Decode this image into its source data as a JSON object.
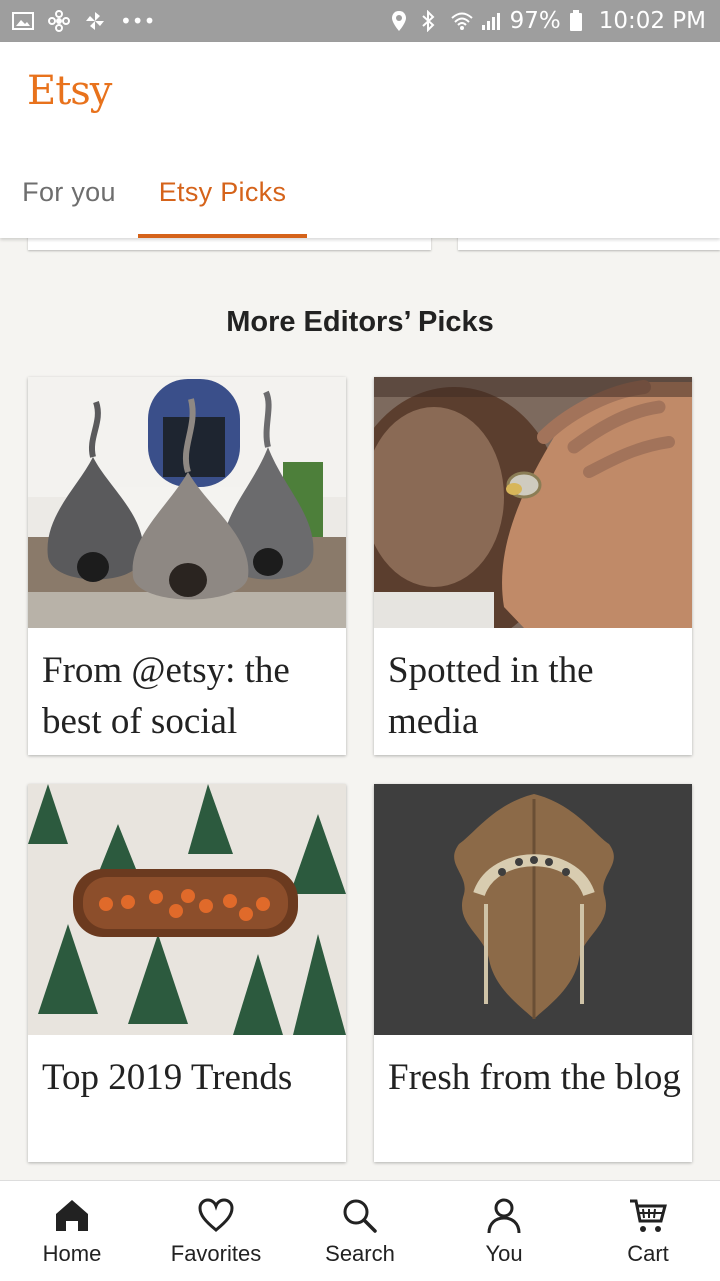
{
  "status_bar": {
    "battery": "97%",
    "time": "10:02 PM"
  },
  "header": {
    "logo": "Etsy"
  },
  "tabs": [
    {
      "label": "For you",
      "active": false
    },
    {
      "label": "Etsy Picks",
      "active": true
    }
  ],
  "section": {
    "title": "More Editors’ Picks"
  },
  "cards": [
    {
      "caption": "From @etsy: the best of social",
      "image": "felt-cat-caves"
    },
    {
      "caption": "Spotted in the media",
      "image": "hand-with-rings"
    },
    {
      "caption": "Top 2019 Trends",
      "image": "wooden-tray-on-tree-print"
    },
    {
      "caption": "Fresh from the blog",
      "image": "moon-phase-headpiece"
    }
  ],
  "bottom_nav": [
    {
      "label": "Home",
      "icon": "home-icon"
    },
    {
      "label": "Favorites",
      "icon": "heart-icon"
    },
    {
      "label": "Search",
      "icon": "search-icon"
    },
    {
      "label": "You",
      "icon": "person-icon"
    },
    {
      "label": "Cart",
      "icon": "cart-icon"
    }
  ],
  "colors": {
    "accent": "#d5631a",
    "logo": "#e8721c",
    "background": "#f5f4f1"
  }
}
